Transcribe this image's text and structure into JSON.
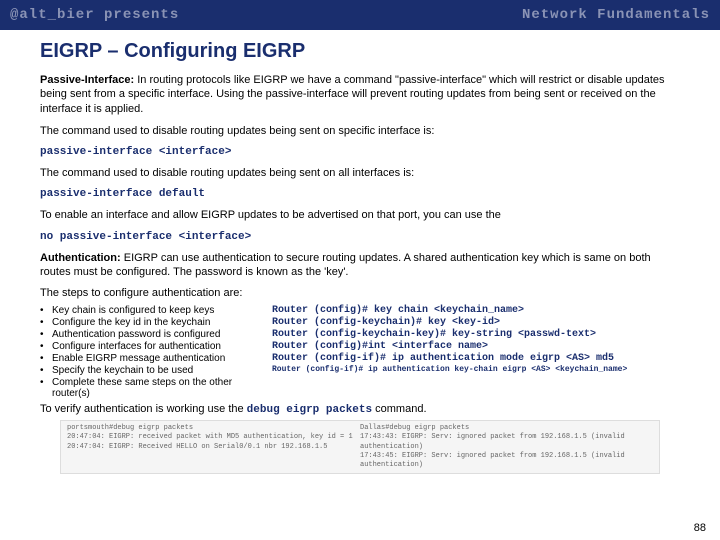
{
  "header": {
    "left": "@alt_bier presents",
    "right": "Network Fundamentals"
  },
  "title": "EIGRP – Configuring EIGRP",
  "passive": {
    "lead": "Passive-Interface:",
    "text": " In routing protocols like EIGRP we have a command \"passive-interface\" which will restrict or disable updates being sent from a specific interface. Using the passive-interface will prevent routing updates from being sent or received on the interface it is applied."
  },
  "cmd1_intro": "The command used to disable routing updates being sent on specific interface is:",
  "cmd1": "passive-interface <interface>",
  "cmd2_intro": "The command used to disable routing updates being sent on all interfaces is:",
  "cmd2": "passive-interface default",
  "cmd3_intro": "To enable an interface and allow EIGRP updates to be advertised on that port, you can use the",
  "cmd3": "no passive-interface <interface>",
  "auth": {
    "lead": "Authentication:",
    "text": " EIGRP can use authentication to secure routing updates. A shared authentication key which is same on both routes must be configured. The password is known as the 'key'."
  },
  "steps_intro": "The steps to configure authentication are:",
  "steps": [
    {
      "text": "Key chain is configured to keep keys",
      "cmd": "Router (config)# key chain <keychain_name>"
    },
    {
      "text": "Configure the key id in the keychain",
      "cmd": "Router (config-keychain)# key <key-id>"
    },
    {
      "text": "Authentication password is configured",
      "cmd": "Router (config-keychain-key)# key-string <passwd-text>"
    },
    {
      "text": "Configure interfaces for authentication",
      "cmd": "Router (config)#int <interface name>"
    },
    {
      "text": "Enable EIGRP message authentication",
      "cmd": "Router (config-if)# ip authentication mode eigrp <AS> md5"
    },
    {
      "text": "Specify the keychain to be used",
      "cmd": "Router (config-if)# ip authentication key-chain eigrp <AS> <keychain_name>",
      "small": true
    },
    {
      "text": "Complete these same steps on the other router(s)",
      "cmd": ""
    }
  ],
  "verify": {
    "pre": "To verify authentication is working use the ",
    "cmd": "debug eigrp packets",
    "post": " command."
  },
  "terminal": {
    "left": [
      "portsmouth#debug eigrp packets",
      "20:47:04: EIGRP: received packet with MD5 authentication, key id = 1",
      "20:47:04: EIGRP: Received HELLO on Serial0/0.1 nbr 192.168.1.5"
    ],
    "right": [
      "Dallas#debug eigrp packets",
      "17:43:43: EIGRP: Serv: ignored packet from 192.168.1.5 (invalid authentication)",
      "17:43:45: EIGRP: Serv: ignored packet from 192.168.1.5 (invalid authentication)"
    ]
  },
  "page_num": "88"
}
